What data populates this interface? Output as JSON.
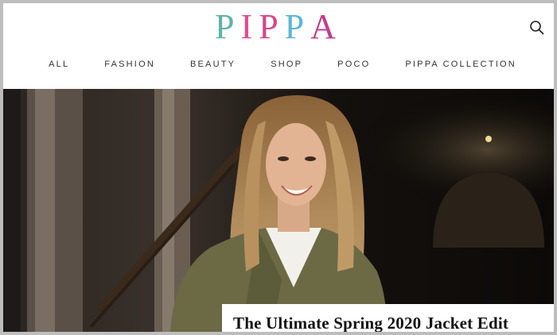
{
  "brand": {
    "logo_text": [
      "P",
      "I",
      "P",
      "P",
      "A"
    ]
  },
  "header": {
    "search_icon": "search-icon"
  },
  "nav": {
    "items": [
      {
        "label": "ALL"
      },
      {
        "label": "FASHION"
      },
      {
        "label": "BEAUTY"
      },
      {
        "label": "SHOP"
      },
      {
        "label": "POCO"
      },
      {
        "label": "PIPPA COLLECTION"
      }
    ]
  },
  "hero": {
    "headline": "The Ultimate Spring 2020 Jacket Edit",
    "image": "woman-in-green-jacket-photo"
  },
  "colors": {
    "page_border": "#bdbdbd",
    "nav_text": "#333333",
    "headline_text": "#111111",
    "jacket_green": "#6b6a45"
  }
}
